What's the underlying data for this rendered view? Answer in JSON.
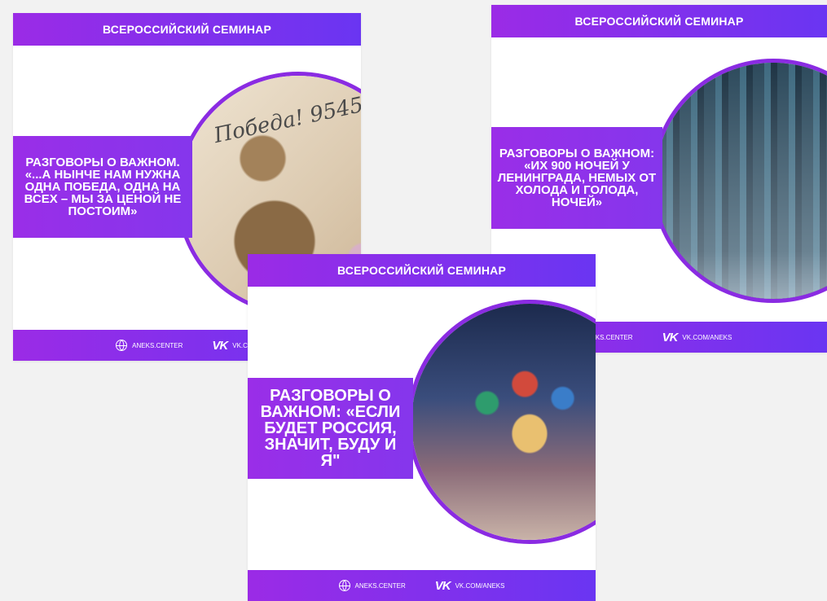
{
  "header_title": "ВСЕРОССИЙСКИЙ СЕМИНАР",
  "footer": {
    "site_label": "ANEKS.CENTER",
    "vk_label": "VK.COM/ANEKS",
    "vk_label_truncated": "VK.COM",
    "site_label_truncated": "NEKS.CENTER"
  },
  "cards": [
    {
      "band_text": "РАЗГОВОРЫ О ВАЖНОМ. «...А НЫНЧЕ НАМ НУЖНА ОДНА ПОБЕДА, ОДНА НА ВСЕХ – МЫ ЗА ЦЕНОЙ НЕ ПОСТОИМ»",
      "image_text": "Победа! 9545",
      "image_icon": "victory-soldier-image"
    },
    {
      "band_text": "РАЗГОВОРЫ О ВАЖНОМ: «ИХ 900 НОЧЕЙ У ЛЕНИНГРАДА, НЕМЫХ ОТ ХОЛОДА И ГОЛОДА, НОЧЕЙ»",
      "image_icon": "leningrad-siege-image"
    },
    {
      "band_text": "РАЗГОВОРЫ О ВАЖНОМ: «ЕСЛИ БУДЕТ РОССИЯ, ЗНАЧИТ, БУДУ И Я\"",
      "image_icon": "st-basils-cathedral-image"
    }
  ],
  "colors": {
    "brand_purple": "#8a2be2",
    "gradient_start": "#9b2be6",
    "gradient_end": "#6a35f2",
    "background": "#f2f2f2"
  }
}
